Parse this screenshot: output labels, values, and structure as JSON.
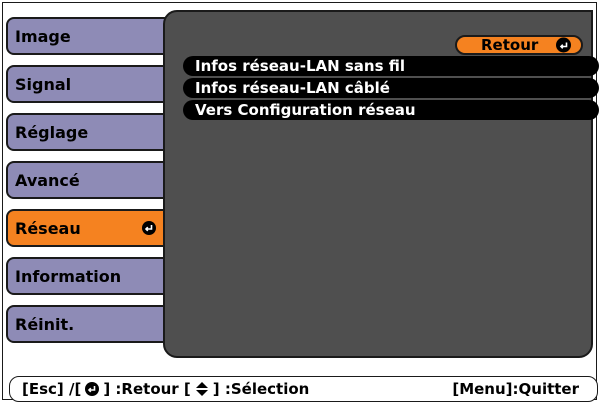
{
  "menu": {
    "items": [
      {
        "label": "Image"
      },
      {
        "label": "Signal"
      },
      {
        "label": "Réglage"
      },
      {
        "label": "Avancé"
      },
      {
        "label": "Réseau"
      },
      {
        "label": "Information"
      },
      {
        "label": "Réinit."
      }
    ],
    "active_index": 4
  },
  "panel": {
    "retour_label": "Retour",
    "submenu": [
      {
        "label": "Infos réseau-LAN sans fil"
      },
      {
        "label": "Infos réseau-LAN câblé"
      },
      {
        "label": "Vers Configuration réseau"
      }
    ]
  },
  "footer": {
    "esc_text": "[Esc] /[",
    "retour_text": "] :Retour  [",
    "selection_text": "] :Sélection",
    "quit_text": "[Menu]:Quitter"
  },
  "colors": {
    "accent": "#f58220",
    "menu_bg": "#8e8bb6",
    "panel_bg": "#4f4f4f"
  },
  "icons": {
    "enter": "enter-return-icon",
    "updown": "up-down-arrow-icon"
  }
}
